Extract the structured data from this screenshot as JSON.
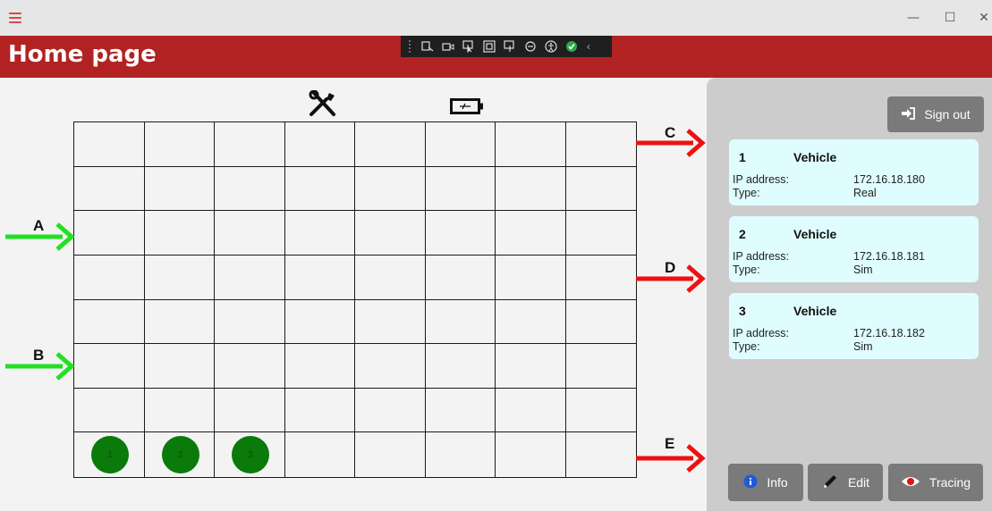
{
  "window": {
    "minimize_glyph": "—",
    "maximize_glyph": "☐",
    "close_glyph": "✕"
  },
  "header": {
    "title": "Home page"
  },
  "map": {
    "rows": 8,
    "cols": 8,
    "vehicles": [
      {
        "label": "1",
        "row": 8,
        "col": 1
      },
      {
        "label": "2",
        "row": 8,
        "col": 2
      },
      {
        "label": "3",
        "row": 8,
        "col": 3
      }
    ],
    "entries": [
      {
        "label": "A",
        "color": "#22e022"
      },
      {
        "label": "B",
        "color": "#22e022"
      }
    ],
    "exits": [
      {
        "label": "C",
        "color": "#ee1111"
      },
      {
        "label": "D",
        "color": "#ee1111"
      },
      {
        "label": "E",
        "color": "#ee1111"
      }
    ],
    "icons": [
      "tools-icon",
      "battery-icon"
    ]
  },
  "panel": {
    "sign_out_label": "Sign out",
    "vehicles": [
      {
        "number": "1",
        "title": "Vehicle",
        "ip_label": "IP address:",
        "ip": "172.16.18.180",
        "type_label": "Type:",
        "type": "Real"
      },
      {
        "number": "2",
        "title": "Vehicle",
        "ip_label": "IP address:",
        "ip": "172.16.18.181",
        "type_label": "Type:",
        "type": "Sim"
      },
      {
        "number": "3",
        "title": "Vehicle",
        "ip_label": "IP address:",
        "ip": "172.16.18.182",
        "type_label": "Type:",
        "type": "Sim"
      }
    ],
    "buttons": {
      "info": "Info",
      "edit": "Edit",
      "tracing": "Tracing"
    }
  },
  "colors": {
    "header": "#b22222",
    "panel": "#cccccc",
    "card": "#dffcfe",
    "button": "#7a7a7a",
    "vehicle_dot": "#0a7a0a",
    "entry_arrow": "#22e022",
    "exit_arrow": "#ee1111"
  }
}
